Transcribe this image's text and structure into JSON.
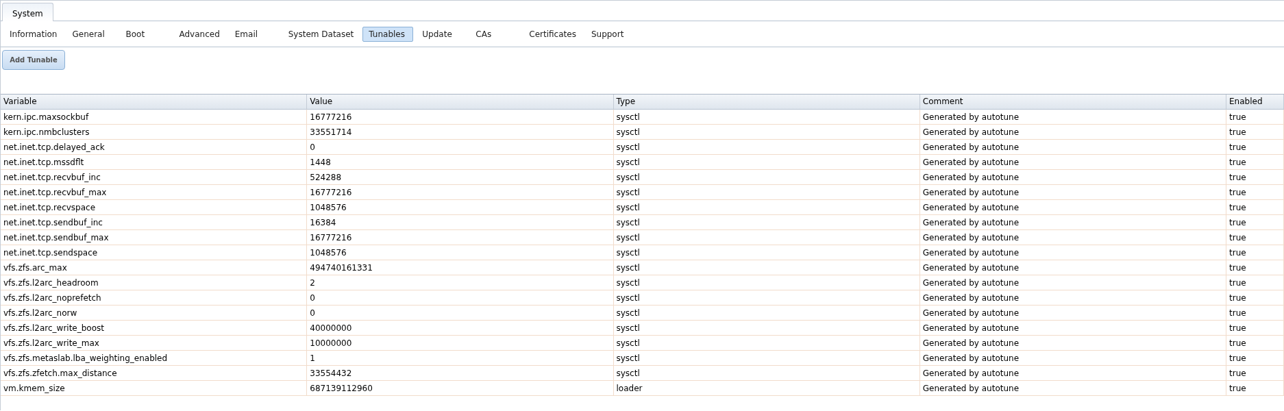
{
  "top_tabs": [
    {
      "label": "System",
      "selected": true
    }
  ],
  "sub_tabs": [
    {
      "label": "Information",
      "selected": false
    },
    {
      "label": "General",
      "selected": false
    },
    {
      "label": "Boot",
      "selected": false
    },
    {
      "label": "Advanced",
      "selected": false
    },
    {
      "label": "Email",
      "selected": false
    },
    {
      "label": "System Dataset",
      "selected": false
    },
    {
      "label": "Tunables",
      "selected": true
    },
    {
      "label": "Update",
      "selected": false
    },
    {
      "label": "CAs",
      "selected": false
    },
    {
      "label": "Certificates",
      "selected": false
    },
    {
      "label": "Support",
      "selected": false
    }
  ],
  "add_button": "Add Tunable",
  "table": {
    "columns": [
      "Variable",
      "Value",
      "Type",
      "Comment",
      "Enabled"
    ],
    "rows": [
      [
        "kern.ipc.maxsockbuf",
        "16777216",
        "sysctl",
        "Generated by autotune",
        "true"
      ],
      [
        "kern.ipc.nmbclusters",
        "33551714",
        "sysctl",
        "Generated by autotune",
        "true"
      ],
      [
        "net.inet.tcp.delayed_ack",
        "0",
        "sysctl",
        "Generated by autotune",
        "true"
      ],
      [
        "net.inet.tcp.mssdflt",
        "1448",
        "sysctl",
        "Generated by autotune",
        "true"
      ],
      [
        "net.inet.tcp.recvbuf_inc",
        "524288",
        "sysctl",
        "Generated by autotune",
        "true"
      ],
      [
        "net.inet.tcp.recvbuf_max",
        "16777216",
        "sysctl",
        "Generated by autotune",
        "true"
      ],
      [
        "net.inet.tcp.recvspace",
        "1048576",
        "sysctl",
        "Generated by autotune",
        "true"
      ],
      [
        "net.inet.tcp.sendbuf_inc",
        "16384",
        "sysctl",
        "Generated by autotune",
        "true"
      ],
      [
        "net.inet.tcp.sendbuf_max",
        "16777216",
        "sysctl",
        "Generated by autotune",
        "true"
      ],
      [
        "net.inet.tcp.sendspace",
        "1048576",
        "sysctl",
        "Generated by autotune",
        "true"
      ],
      [
        "vfs.zfs.arc_max",
        "494740161331",
        "sysctl",
        "Generated by autotune",
        "true"
      ],
      [
        "vfs.zfs.l2arc_headroom",
        "2",
        "sysctl",
        "Generated by autotune",
        "true"
      ],
      [
        "vfs.zfs.l2arc_noprefetch",
        "0",
        "sysctl",
        "Generated by autotune",
        "true"
      ],
      [
        "vfs.zfs.l2arc_norw",
        "0",
        "sysctl",
        "Generated by autotune",
        "true"
      ],
      [
        "vfs.zfs.l2arc_write_boost",
        "40000000",
        "sysctl",
        "Generated by autotune",
        "true"
      ],
      [
        "vfs.zfs.l2arc_write_max",
        "10000000",
        "sysctl",
        "Generated by autotune",
        "true"
      ],
      [
        "vfs.zfs.metaslab.lba_weighting_enabled",
        "1",
        "sysctl",
        "Generated by autotune",
        "true"
      ],
      [
        "vfs.zfs.zfetch.max_distance",
        "33554432",
        "sysctl",
        "Generated by autotune",
        "true"
      ],
      [
        "vm.kmem_size",
        "687139112960",
        "loader",
        "Generated by autotune",
        "true"
      ]
    ]
  }
}
